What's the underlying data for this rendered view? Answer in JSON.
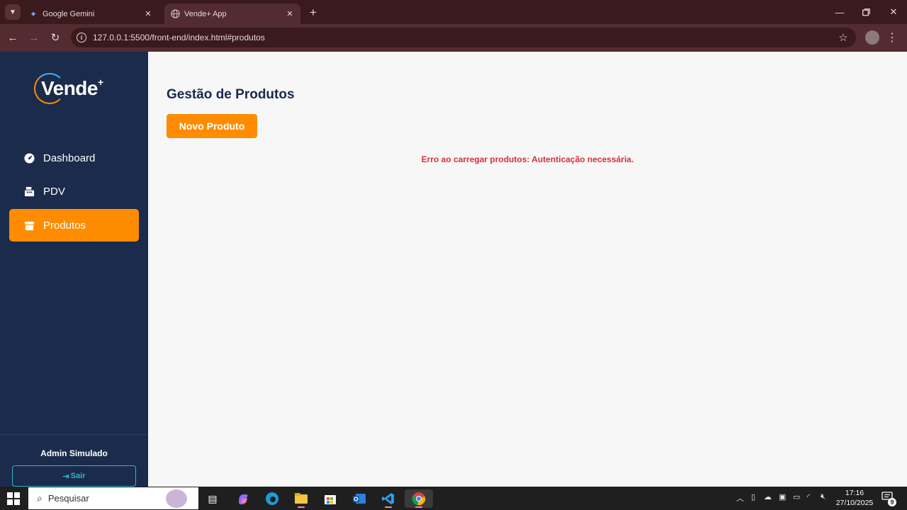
{
  "browser": {
    "tabs": [
      {
        "title": "Google Gemini",
        "icon": "gemini-icon"
      },
      {
        "title": "Vende+ App",
        "icon": "globe-icon"
      }
    ],
    "url": "127.0.0.1:5500/front-end/index.html#produtos",
    "theme_color": "#522c30"
  },
  "app": {
    "logo_text": "Vende",
    "logo_plus": "+",
    "nav": [
      {
        "label": "Dashboard",
        "icon": "gauge-icon",
        "active": false
      },
      {
        "label": "PDV",
        "icon": "cash-register-icon",
        "active": false
      },
      {
        "label": "Produtos",
        "icon": "box-icon",
        "active": true
      }
    ],
    "user_name": "Admin Simulado",
    "logout_label": "Sair",
    "colors": {
      "sidebar": "#1a2b4c",
      "accent": "#ff8c00",
      "error": "#d9303a",
      "logout": "#2fb5c4"
    }
  },
  "main": {
    "title": "Gestão de Produtos",
    "new_button": "Novo Produto",
    "error": "Erro ao carregar produtos: Autenticação necessária."
  },
  "taskbar": {
    "search_placeholder": "Pesquisar",
    "time": "17:16",
    "date": "27/10/2025",
    "notifications": "9"
  }
}
